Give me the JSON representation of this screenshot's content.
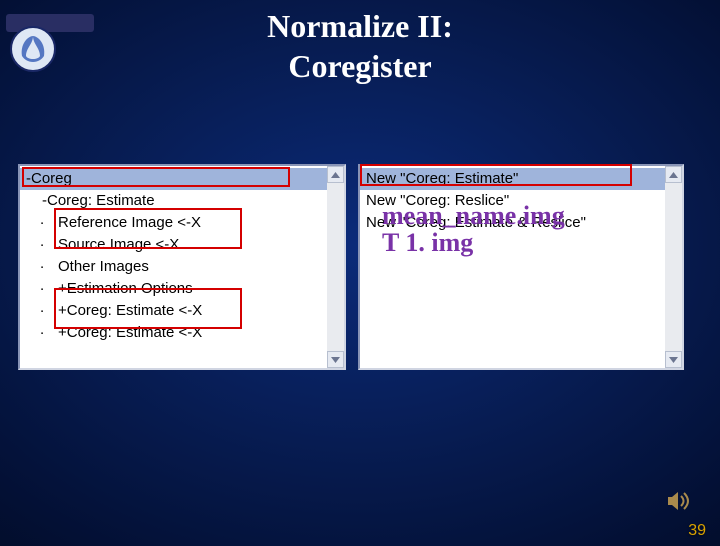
{
  "title_line1": "Normalize II:",
  "title_line2": "Coregister",
  "left_panel": {
    "items": {
      "root": "-Coreg",
      "l1": "-Coreg: Estimate",
      "ref": "Reference Image <-X",
      "src": "Source Image <-X",
      "other": "Other Images",
      "estopt": "+Estimation Options",
      "est2": "+Coreg: Estimate <-X",
      "est3": "+Coreg: Estimate <-X"
    }
  },
  "right_panel": {
    "items": {
      "est": "New \"Coreg: Estimate\"",
      "resl": "New \"Coreg: Reslice\"",
      "estresl": "New \"Coreg: Estimate & Reslice\""
    }
  },
  "overlays": {
    "mean": "mean_name.img",
    "t1": "T 1. img"
  },
  "page_number": "39"
}
